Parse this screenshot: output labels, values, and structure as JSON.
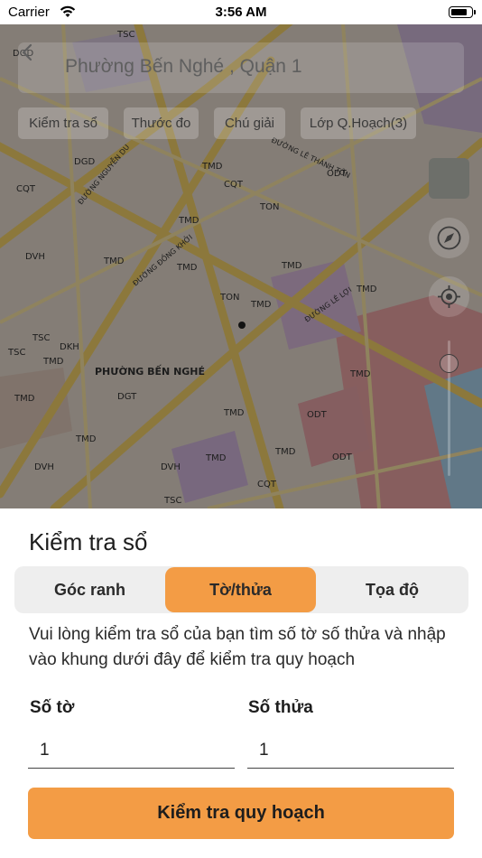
{
  "status_bar": {
    "carrier": "Carrier",
    "time": "3:56 AM"
  },
  "map": {
    "title": "Phường Bến Nghé , Quận 1",
    "tabs": [
      {
        "label": "Kiểm tra sổ"
      },
      {
        "label": "Thước đo"
      },
      {
        "label": "Chú giải"
      },
      {
        "label": "Lớp Q.Hoạch(3)"
      }
    ],
    "labels": [
      "TSC",
      "DGD",
      "CQT",
      "TMD",
      "TON",
      "ODT",
      "DVH",
      "DKH",
      "TSC",
      "TMD",
      "TMD",
      "TMD",
      "TMD",
      "ODT",
      "DVH",
      "TMD",
      "CQT",
      "TSC",
      "TMD",
      "TMD",
      "TMD",
      "TMD",
      "DVH",
      "TSC",
      "CQT",
      "DGD",
      "ODT",
      "TMD",
      "TMD",
      "TON",
      "TMD",
      "TMD",
      "DGT",
      "PHƯỜNG BẾN NGHÉ",
      "ĐƯỜNG ĐỒNG KHỞI",
      "ĐƯỜNG LÊ THÁNH TÔN",
      "ĐƯỜNG LÊ LỢI",
      "ĐƯỜNG NGUYỄN DU"
    ]
  },
  "sheet": {
    "title": "Kiểm tra sổ",
    "segments": [
      {
        "label": "Góc ranh",
        "active": false
      },
      {
        "label": "Tờ/thửa",
        "active": true
      },
      {
        "label": "Tọa độ",
        "active": false
      }
    ],
    "hint": "Vui lòng kiểm tra sổ của bạn tìm số tờ số thửa và nhập vào khung dưới đây để kiểm tra quy hoạch",
    "fields": [
      {
        "label": "Số tờ",
        "value": "1"
      },
      {
        "label": "Số thửa",
        "value": "1"
      }
    ],
    "submit_label": "Kiểm tra quy hoạch"
  },
  "colors": {
    "accent": "#f39c45",
    "segment_bg": "#eeeeee",
    "map_dim": "rgba(0,0,0,0.42)"
  },
  "icons": [
    "wifi-icon",
    "battery-icon",
    "back-icon",
    "compass-icon",
    "locate-icon",
    "map-layer-icon"
  ]
}
